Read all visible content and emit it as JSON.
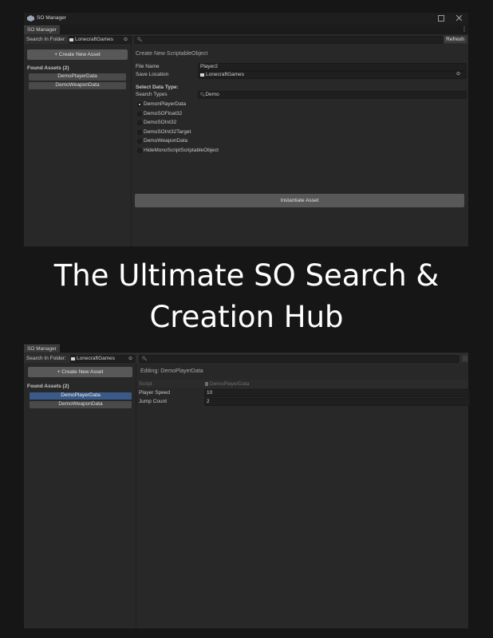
{
  "window1": {
    "title": "SO Manager",
    "tab": "SO Manager",
    "toolbar": {
      "search_folder_label": "Search In Folder:",
      "folder_value": "LonecraftGames",
      "search_placeholder": "",
      "refresh_label": "Refresh"
    },
    "sidebar": {
      "create_button": "+ Create New Asset",
      "found_label": "Found Assets (2)",
      "items": [
        "DemoPlayerData",
        "DemoWeaponData"
      ]
    },
    "main": {
      "heading": "Create New ScriptableObject",
      "file_name_label": "File Name",
      "file_name_value": "Player2",
      "save_location_label": "Save Location",
      "save_location_value": "LonecraftGames",
      "select_type_label": "Select Data Type:",
      "search_types_label": "Search Types",
      "search_types_value": "Demo",
      "types": [
        "DemonPlayerData",
        "DemoSOFloat32",
        "DemoSOInt32",
        "DemoSOInt32Target",
        "DemoWeaponData",
        "HideMonoScriptScriptableObject"
      ],
      "selected_type_index": 0,
      "instantiate_button": "Instantiate Asset"
    }
  },
  "hero": {
    "line1": "The Ultimate SO Search &",
    "line2": "Creation Hub"
  },
  "window2": {
    "tab": "SO Manager",
    "toolbar": {
      "search_folder_label": "Search In Folder:",
      "folder_value": "LonecraftGames"
    },
    "sidebar": {
      "create_button": "+ Create New Asset",
      "found_label": "Found Assets (2)",
      "items": [
        "DemoPlayerData",
        "DemoWeaponData"
      ],
      "selected_index": 0
    },
    "main": {
      "heading": "Editing: DemoPlayerData",
      "rows": [
        {
          "label": "Script",
          "value": "DemoPlayerData"
        },
        {
          "label": "Player Speed",
          "value": "10"
        },
        {
          "label": "Jump Count",
          "value": "2"
        }
      ]
    }
  },
  "colors": {
    "page_bg": "#161616",
    "panel_bg": "#282828",
    "selection": "#3a5b8a",
    "button_bg": "#585858"
  }
}
